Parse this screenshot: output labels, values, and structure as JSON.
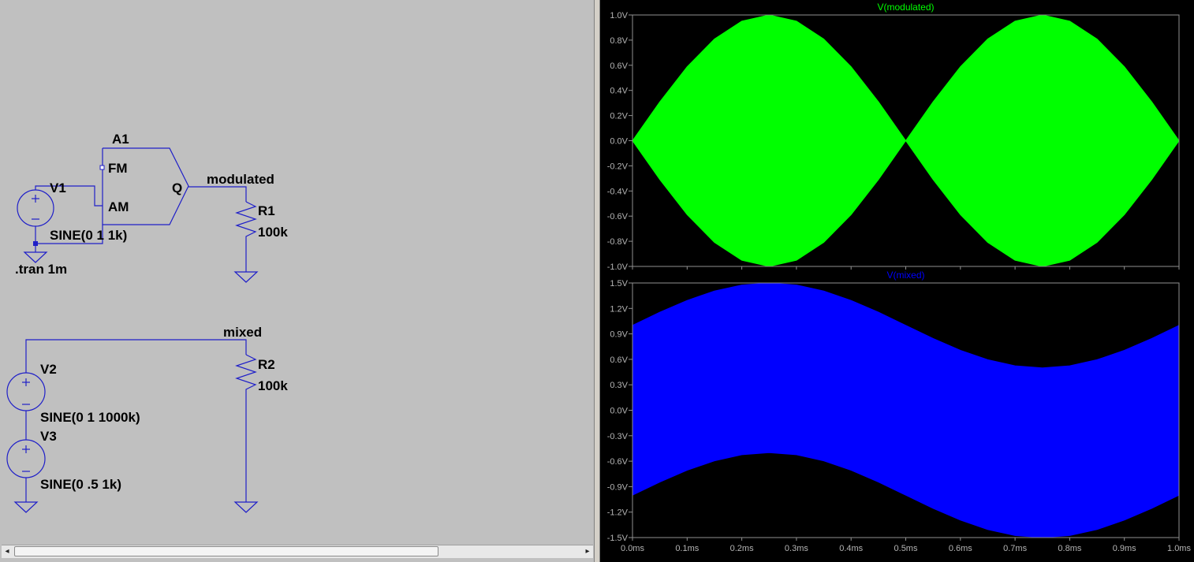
{
  "schematic": {
    "components": {
      "a1_name": "A1",
      "a1_pin_fm": "FM",
      "a1_pin_am": "AM",
      "a1_pin_q": "Q",
      "v1_name": "V1",
      "v1_value": "SINE(0 1 1k)",
      "r1_name": "R1",
      "r1_value": "100k",
      "v2_name": "V2",
      "v2_value": "SINE(0 1 1000k)",
      "v3_name": "V3",
      "v3_value": "SINE(0 .5 1k)",
      "r2_name": "R2",
      "r2_value": "100k"
    },
    "nets": {
      "modulated": "modulated",
      "mixed": "mixed"
    },
    "directive": ".tran 1m"
  },
  "scrollbar": {
    "left_arrow": "◂",
    "right_arrow": "▸"
  },
  "colors": {
    "schematic_bg": "#c0c0c0",
    "wire": "#1f1fc8",
    "modulated_trace": "#00ff00",
    "mixed_trace": "#0000ff",
    "plot_bg": "#000000"
  },
  "chart_data": [
    {
      "type": "area",
      "title": "V(modulated)",
      "title_color": "#00ff00",
      "x_ticks": [
        "0.0ms",
        "0.1ms",
        "0.2ms",
        "0.3ms",
        "0.4ms",
        "0.5ms",
        "0.6ms",
        "0.7ms",
        "0.8ms",
        "0.9ms",
        "1.0ms"
      ],
      "y_ticks": [
        "1.0V",
        "0.8V",
        "0.6V",
        "0.4V",
        "0.2V",
        "0.0V",
        "-0.2V",
        "-0.4V",
        "-0.6V",
        "-0.8V",
        "-1.0V"
      ],
      "xlim": [
        0,
        1.0
      ],
      "ylim": [
        -1.0,
        1.0
      ],
      "envelope_x_ms": [
        0,
        0.05,
        0.1,
        0.15,
        0.2,
        0.25,
        0.3,
        0.35,
        0.4,
        0.45,
        0.5,
        0.55,
        0.6,
        0.65,
        0.7,
        0.75,
        0.8,
        0.85,
        0.9,
        0.95,
        1.0
      ],
      "envelope_upper_V": [
        0,
        0.309,
        0.588,
        0.809,
        0.951,
        1.0,
        0.951,
        0.809,
        0.588,
        0.309,
        0,
        0.309,
        0.588,
        0.809,
        0.951,
        1.0,
        0.951,
        0.809,
        0.588,
        0.309,
        0
      ],
      "envelope_lower_V": [
        0,
        -0.309,
        -0.588,
        -0.809,
        -0.951,
        -1.0,
        -0.951,
        -0.809,
        -0.588,
        -0.309,
        0,
        -0.309,
        -0.588,
        -0.809,
        -0.951,
        -1.0,
        -0.951,
        -0.809,
        -0.588,
        -0.309,
        0
      ],
      "color": "#00ff00"
    },
    {
      "type": "area",
      "title": "V(mixed)",
      "title_color": "#0000ff",
      "x_ticks": [
        "0.0ms",
        "0.1ms",
        "0.2ms",
        "0.3ms",
        "0.4ms",
        "0.5ms",
        "0.6ms",
        "0.7ms",
        "0.8ms",
        "0.9ms",
        "1.0ms"
      ],
      "y_ticks": [
        "1.5V",
        "1.2V",
        "0.9V",
        "0.6V",
        "0.3V",
        "0.0V",
        "-0.3V",
        "-0.6V",
        "-0.9V",
        "-1.2V",
        "-1.5V"
      ],
      "xlim": [
        0,
        1.0
      ],
      "ylim": [
        -1.5,
        1.5
      ],
      "envelope_x_ms": [
        0,
        0.05,
        0.1,
        0.15,
        0.2,
        0.25,
        0.3,
        0.35,
        0.4,
        0.45,
        0.5,
        0.55,
        0.6,
        0.65,
        0.7,
        0.75,
        0.8,
        0.85,
        0.9,
        0.95,
        1.0
      ],
      "envelope_upper_V": [
        1.0,
        1.155,
        1.294,
        1.405,
        1.476,
        1.5,
        1.476,
        1.405,
        1.294,
        1.155,
        1.0,
        0.845,
        0.706,
        0.595,
        0.524,
        0.5,
        0.524,
        0.595,
        0.706,
        0.845,
        1.0
      ],
      "envelope_lower_V": [
        -1.0,
        -0.845,
        -0.706,
        -0.595,
        -0.524,
        -0.5,
        -0.524,
        -0.595,
        -0.706,
        -0.845,
        -1.0,
        -1.155,
        -1.294,
        -1.405,
        -1.476,
        -1.5,
        -1.476,
        -1.405,
        -1.294,
        -1.155,
        -1.0
      ],
      "color": "#0000ff"
    }
  ]
}
